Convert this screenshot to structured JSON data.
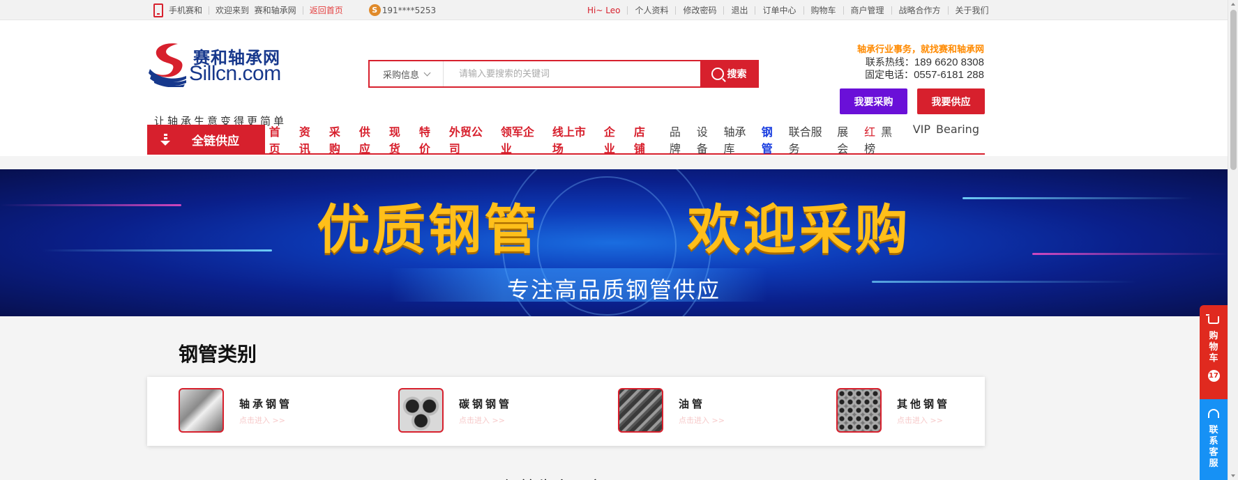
{
  "topbar": {
    "mobile": "手机赛和",
    "welcome": "欢迎来到",
    "site": "赛和轴承网",
    "home_link": "返回首页",
    "coin_symbol": "S",
    "phone": "191****5253",
    "greeting": "Hi~ Leo",
    "links": [
      "个人资料",
      "修改密码",
      "退出",
      "订单中心",
      "购物车",
      "商户管理",
      "战略合作方",
      "关于我们"
    ]
  },
  "logo": {
    "cn": "赛和轴承网",
    "en": "Sillcn.com",
    "slogan": "让轴承生意变得更简单"
  },
  "search": {
    "category": "采购信息",
    "placeholder": "请输入要搜索的关键词",
    "button": "搜索"
  },
  "contact": {
    "tagline": "轴承行业事务，就找赛和轴承网",
    "hotline_label": "联系热线：",
    "hotline": "189 6620 8308",
    "tel_label": "固定电话：",
    "tel": "0557-6181 288"
  },
  "actions": {
    "buy": "我要采购",
    "sell": "我要供应"
  },
  "nav": {
    "all_supply": "全链供应",
    "main": [
      "首页",
      "资讯",
      "采购",
      "供应",
      "现货",
      "特价",
      "外贸公司",
      "领军企业",
      "线上市场",
      "企业",
      "店铺"
    ],
    "sub": [
      "品牌",
      "设备",
      "轴承库",
      "钢管",
      "联合服务",
      "展会"
    ],
    "redblack_red": "红",
    "redblack_rest": "黑榜",
    "vip": "VIP",
    "bearing": "Bearing"
  },
  "banner": {
    "title": "优质钢管   欢迎采购",
    "subtitle": "专注高品质钢管供应"
  },
  "categories": {
    "title": "钢管类别",
    "items": [
      {
        "name": "轴承钢管",
        "link": "点击进入 >>"
      },
      {
        "name": "碳钢钢管",
        "link": "点击进入 >>"
      },
      {
        "name": "油管",
        "link": "点击进入 >>"
      },
      {
        "name": "其他钢管",
        "link": "点击进入 >>"
      }
    ]
  },
  "next_section": "钢管生产厂家",
  "float": {
    "cart": "购物车",
    "cart_count": "17",
    "service": "联系客服"
  },
  "colors": {
    "brand_red": "#d7202d",
    "brand_blue": "#17388c",
    "purple": "#6a10d8",
    "service_blue": "#1691f5",
    "gold": "#ffbf1a"
  }
}
